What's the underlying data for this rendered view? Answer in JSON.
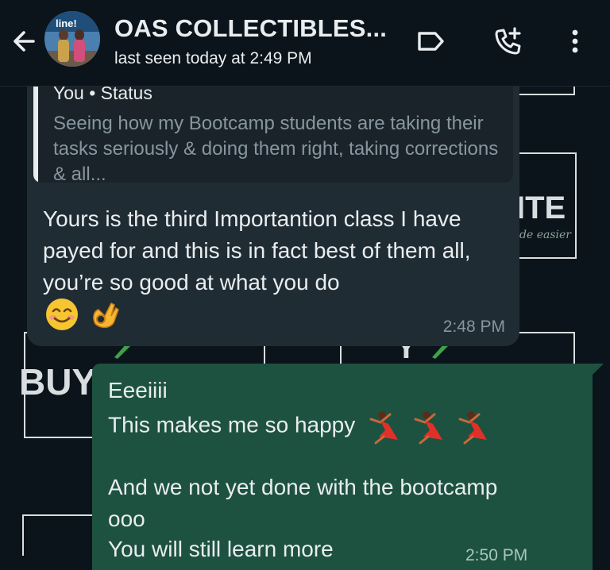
{
  "header": {
    "title": "OAS COLLECTIBLES...",
    "status": "last seen today at 2:49 PM",
    "avatar_text": "line!"
  },
  "wallpaper": {
    "fragments": [
      "ITE",
      "de easier",
      "BUY",
      "Y"
    ]
  },
  "messages": {
    "incoming": {
      "quote_author": "You • Status",
      "quote_text": "Seeing how my Bootcamp students are taking their tasks seriously & doing them right, taking corrections & all...",
      "text": "Yours is the third Importantion class I have payed for and this is in fact best of them all, you’re so good  at what you do",
      "time": "2:48 PM"
    },
    "outgoing": {
      "line1": "Eeeiiii",
      "line2": "This makes me so happy",
      "line3": "And we not yet done with the bootcamp",
      "line4": "ooo",
      "line5": "You will still learn more",
      "time": "2:50 PM"
    }
  },
  "colors": {
    "background": "#0b141a",
    "incoming_bubble": "#202c33",
    "outgoing_bubble": "#1e5240",
    "secondary_text": "#8696a0"
  },
  "icons": [
    "back-arrow-icon",
    "label-icon",
    "add-call-icon",
    "more-vert-icon",
    "smiling-face-emoji",
    "ok-hand-emoji",
    "dancing-woman-emoji"
  ]
}
